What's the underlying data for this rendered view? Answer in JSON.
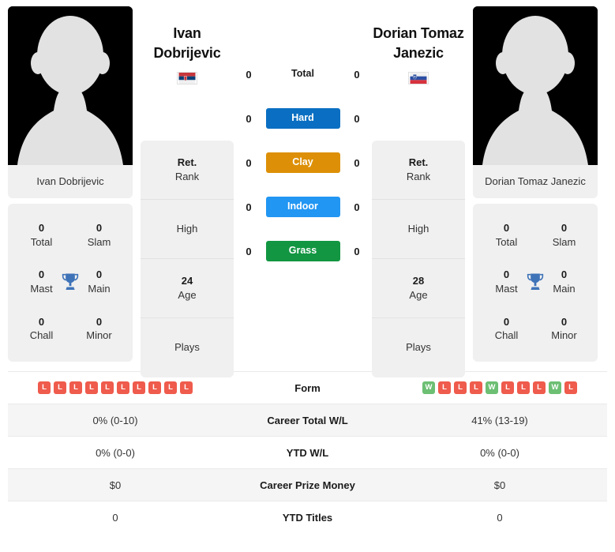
{
  "colors": {
    "hard": "#0a6fc2",
    "clay": "#dd9007",
    "indoor": "#2196f3",
    "grass": "#129642",
    "win": "#6cbf73",
    "loss": "#ef5b4c",
    "trophy": "#3f73b8",
    "card_bg": "#f0f0f0",
    "row_shade": "#f5f5f5"
  },
  "left_player": {
    "name_line1": "Ivan",
    "name_line2": "Dobrijevic",
    "photo_caption": "Ivan Dobrijevic",
    "flag": "serbia-flag",
    "info": [
      {
        "value": "Ret.",
        "label": "Rank"
      },
      {
        "value": "",
        "label": "High"
      },
      {
        "value": "24",
        "label": "Age"
      },
      {
        "value": "",
        "label": "Plays"
      }
    ],
    "titles_caption": "Ivan Dobrijevic",
    "titles": [
      {
        "num": "0",
        "label": "Total"
      },
      {
        "num": "0",
        "label": "Slam"
      },
      {
        "num": "0",
        "label": "Mast"
      },
      {
        "num": "0",
        "label": "Main"
      },
      {
        "num": "0",
        "label": "Chall"
      },
      {
        "num": "0",
        "label": "Minor"
      }
    ],
    "surface_values": [
      "0",
      "0",
      "0",
      "0",
      "0"
    ],
    "form": [
      "L",
      "L",
      "L",
      "L",
      "L",
      "L",
      "L",
      "L",
      "L",
      "L"
    ],
    "career_total_wl": "0% (0-10)",
    "ytd_wl": "0% (0-0)",
    "career_prize_money": "$0",
    "ytd_titles": "0"
  },
  "right_player": {
    "name_line1": "Dorian Tomaz",
    "name_line2": "Janezic",
    "photo_caption": "Dorian Tomaz Janezic",
    "flag": "slovenia-flag",
    "info": [
      {
        "value": "Ret.",
        "label": "Rank"
      },
      {
        "value": "",
        "label": "High"
      },
      {
        "value": "28",
        "label": "Age"
      },
      {
        "value": "",
        "label": "Plays"
      }
    ],
    "titles_caption": "Dorian Tomaz Janezic",
    "titles": [
      {
        "num": "0",
        "label": "Total"
      },
      {
        "num": "0",
        "label": "Slam"
      },
      {
        "num": "0",
        "label": "Mast"
      },
      {
        "num": "0",
        "label": "Main"
      },
      {
        "num": "0",
        "label": "Chall"
      },
      {
        "num": "0",
        "label": "Minor"
      }
    ],
    "surface_values": [
      "0",
      "0",
      "0",
      "0",
      "0"
    ],
    "form": [
      "W",
      "L",
      "L",
      "L",
      "W",
      "L",
      "L",
      "L",
      "W",
      "L"
    ],
    "career_total_wl": "41% (13-19)",
    "ytd_wl": "0% (0-0)",
    "career_prize_money": "$0",
    "ytd_titles": "0"
  },
  "surfaces": [
    {
      "label": "Total",
      "key": "total",
      "badge": false
    },
    {
      "label": "Hard",
      "key": "hard",
      "badge": true
    },
    {
      "label": "Clay",
      "key": "clay",
      "badge": true
    },
    {
      "label": "Indoor",
      "key": "indoor",
      "badge": true
    },
    {
      "label": "Grass",
      "key": "grass",
      "badge": true
    }
  ],
  "table_rows": [
    {
      "label": "Form",
      "type": "form",
      "shaded": false
    },
    {
      "label": "Career Total W/L",
      "type": "text",
      "key": "career_total_wl",
      "shaded": true
    },
    {
      "label": "YTD W/L",
      "type": "text",
      "key": "ytd_wl",
      "shaded": false
    },
    {
      "label": "Career Prize Money",
      "type": "text",
      "key": "career_prize_money",
      "shaded": true
    },
    {
      "label": "YTD Titles",
      "type": "text",
      "key": "ytd_titles",
      "shaded": false
    }
  ]
}
